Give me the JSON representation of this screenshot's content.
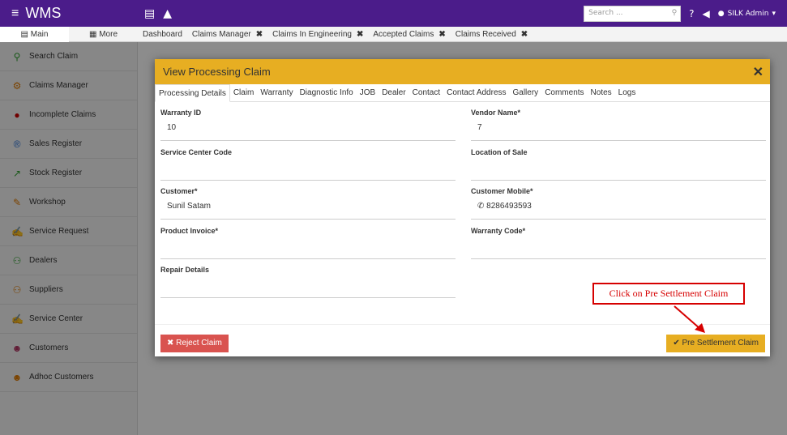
{
  "topbar": {
    "brand": "WMS",
    "search_placeholder": "Search ...",
    "user": "SILK Admin"
  },
  "left_tabs": [
    "Main",
    "More"
  ],
  "page_tabs": [
    {
      "label": "Dashboard",
      "closable": false
    },
    {
      "label": "Claims Manager",
      "closable": true
    },
    {
      "label": "Claims In Engineering",
      "closable": true
    },
    {
      "label": "Accepted Claims",
      "closable": true
    },
    {
      "label": "Claims Received",
      "closable": true
    }
  ],
  "sidebar": {
    "items": [
      {
        "label": "Search Claim",
        "icon": "search-icon",
        "color": "#2ea12e"
      },
      {
        "label": "Claims Manager",
        "icon": "gears-icon",
        "color": "#e07b00"
      },
      {
        "label": "Incomplete Claims",
        "icon": "alert-icon",
        "color": "#cc0000"
      },
      {
        "label": "Sales Register",
        "icon": "registered-icon",
        "color": "#2a6fd6"
      },
      {
        "label": "Stock Register",
        "icon": "chart-line-icon",
        "color": "#2ea12e"
      },
      {
        "label": "Workshop",
        "icon": "wrench-icon",
        "color": "#e07b00"
      },
      {
        "label": "Service Request",
        "icon": "edit-icon",
        "color": "#2a6fd6"
      },
      {
        "label": "Dealers",
        "icon": "handshake-icon",
        "color": "#2ea12e"
      },
      {
        "label": "Suppliers",
        "icon": "handshake-icon",
        "color": "#e07b00"
      },
      {
        "label": "Service Center",
        "icon": "edit-icon",
        "color": "#2a6fd6"
      },
      {
        "label": "Customers",
        "icon": "users-icon",
        "color": "#b03060"
      },
      {
        "label": "Adhoc Customers",
        "icon": "users-icon",
        "color": "#e07b00"
      }
    ]
  },
  "modal": {
    "title": "View Processing Claim",
    "tabs": [
      "Processing Details",
      "Claim",
      "Warranty",
      "Diagnostic Info",
      "JOB",
      "Dealer",
      "Contact",
      "Contact Address",
      "Gallery",
      "Comments",
      "Notes",
      "Logs"
    ],
    "fields": {
      "warranty_id": {
        "label": "Warranty ID",
        "value": "10"
      },
      "vendor_name": {
        "label": "Vendor Name*",
        "value": "7"
      },
      "service_center_code": {
        "label": "Service Center Code",
        "value": ""
      },
      "location_of_sale": {
        "label": "Location of Sale",
        "value": ""
      },
      "customer": {
        "label": "Customer*",
        "value": "Sunil Satam"
      },
      "customer_mobile": {
        "label": "Customer Mobile*",
        "value": "8286493593"
      },
      "product_invoice": {
        "label": "Product Invoice*",
        "value": ""
      },
      "warranty_code": {
        "label": "Warranty Code*",
        "value": ""
      },
      "repair_details": {
        "label": "Repair Details",
        "value": ""
      }
    },
    "reject_label": "Reject Claim",
    "pre_settlement_label": "Pre Settlement Claim"
  },
  "callout": "Click on Pre Settlement Claim",
  "colors": {
    "topbar": "#4b1c8a",
    "modal_header": "#e7ae22",
    "reject": "#d9534f",
    "callout": "#d60000"
  }
}
